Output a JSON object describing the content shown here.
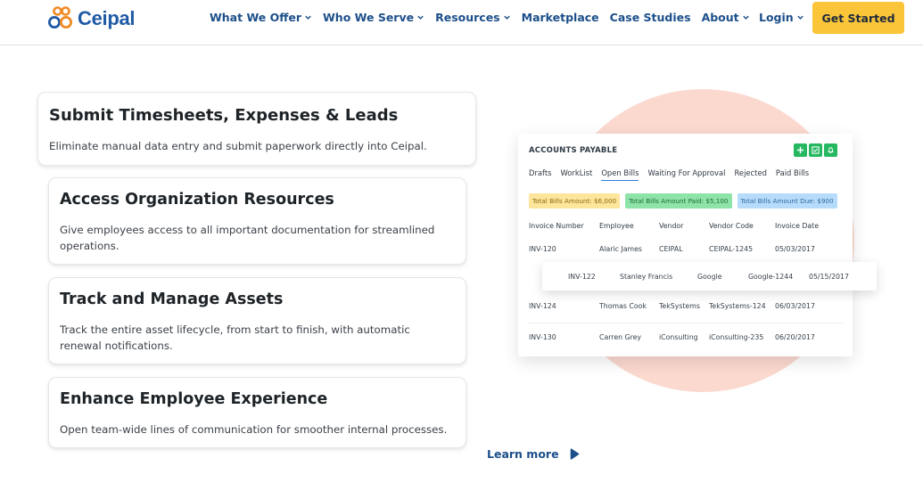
{
  "header": {
    "logo_text": "Ceipal",
    "nav": [
      {
        "label": "What We Offer",
        "dropdown": true
      },
      {
        "label": "Who We Serve",
        "dropdown": true
      },
      {
        "label": "Resources",
        "dropdown": true
      },
      {
        "label": "Marketplace",
        "dropdown": false
      },
      {
        "label": "Case Studies",
        "dropdown": false
      },
      {
        "label": "About",
        "dropdown": true
      }
    ],
    "login_label": "Login",
    "cta_label": "Get Started"
  },
  "features": [
    {
      "title": "Submit Timesheets, Expenses & Leads",
      "description": "Eliminate manual data entry and submit paperwork directly into Ceipal."
    },
    {
      "title": "Access Organization Resources",
      "description": "Give employees access to all important documentation for streamlined operations."
    },
    {
      "title": "Track and Manage Assets",
      "description": "Track the entire asset lifecycle, from start to finish, with automatic renewal notifications."
    },
    {
      "title": "Enhance Employee Experience",
      "description": "Open team-wide lines of communication for smoother internal processes."
    }
  ],
  "panel": {
    "title": "ACCOUNTS PAYABLE",
    "tabs": [
      "Drafts",
      "WorkList",
      "Open Bills",
      "Waiting For Approval",
      "Rejected",
      "Paid Bills"
    ],
    "active_tab": "Open Bills",
    "chips": [
      "Total Bills Amount: $6,000",
      "Total Bills Amount Paid: $5,100",
      "Total Bills Amount Due: $900"
    ],
    "columns": [
      "Invoice Number",
      "Employee",
      "Vendor",
      "Vendor Code",
      "Invoice Date"
    ],
    "rows": [
      [
        "INV-120",
        "Alaric James",
        "CEIPAL",
        "CEIPAL-1245",
        "05/03/2017"
      ],
      [
        "INV-122",
        "Stanley Francis",
        "Google",
        "Google-1244",
        "05/15/2017"
      ],
      [
        "INV-124",
        "Thomas Cook",
        "TekSystems",
        "TekSystems-124",
        "06/03/2017"
      ],
      [
        "INV-130",
        "Carren Grey",
        "iConsulting",
        "iConsulting-235",
        "06/20/2017"
      ]
    ]
  },
  "learn_more_label": "Learn more",
  "colors": {
    "brand_blue": "#1c4f8a",
    "logo_orange": "#f08a24",
    "cta_yellow": "#fbc53a",
    "action_green": "#26b860",
    "blob_peach": "#fbd9cf"
  }
}
